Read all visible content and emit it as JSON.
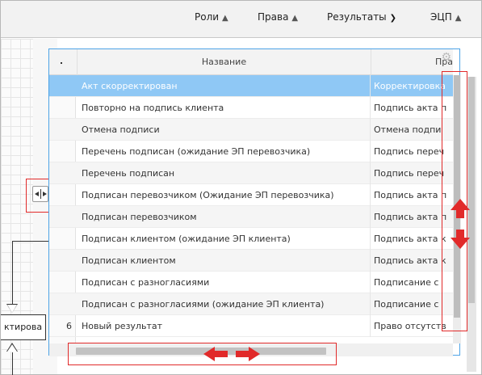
{
  "menu": {
    "items": [
      {
        "label": "Роли",
        "arrow": "chevron-up"
      },
      {
        "label": "Права",
        "arrow": "chevron-up"
      },
      {
        "label": "Результаты",
        "arrow": "chevron-down"
      },
      {
        "label": "ЭЦП",
        "arrow": "chevron-up"
      }
    ]
  },
  "diagram": {
    "box_label": "ктирова"
  },
  "table": {
    "columns": {
      "name": "Название",
      "rights": "Пра"
    },
    "rows": [
      {
        "num": "",
        "name": "Акт скорректирован",
        "rights": "Корректировка",
        "selected": true
      },
      {
        "num": "",
        "name": "Повторно на подпись клиента",
        "rights": "Подпись акта п"
      },
      {
        "num": "",
        "name": "Отмена подписи",
        "rights": "Отмена подпи"
      },
      {
        "num": "",
        "name": "Перечень подписан (ожидание ЭП перевозчика)",
        "rights": "Подпись переч"
      },
      {
        "num": "",
        "name": "Перечень подписан",
        "rights": "Подпись переч"
      },
      {
        "num": "",
        "name": "Подписан перевозчиком (Ожидание ЭП перевозчика)",
        "rights": "Подпись акта п"
      },
      {
        "num": "",
        "name": "Подписан перевозчиком",
        "rights": "Подпись акта п"
      },
      {
        "num": "",
        "name": "Подписан клиентом (ожидание ЭП клиента)",
        "rights": "Подпись акта к"
      },
      {
        "num": "",
        "name": "Подписан клиентом",
        "rights": "Подпись акта к"
      },
      {
        "num": "",
        "name": "Подписан с разногласиями",
        "rights": "Подписание с"
      },
      {
        "num": "",
        "name": "Подписан с разногласиями (ожидание ЭП клиента)",
        "rights": "Подписание с"
      },
      {
        "num": "6",
        "name": "Новый результат",
        "rights": "Право отсутств"
      }
    ]
  },
  "colors": {
    "accent_border": "#4da3e6",
    "selected_row": "#8fc8f5",
    "annotation_red": "#e12a2a"
  },
  "icons": [
    "chevron-up-icon",
    "chevron-down-icon",
    "gear-icon",
    "splitter-icon",
    "resize-vertical-arrow-icon",
    "resize-horizontal-arrow-icon"
  ]
}
